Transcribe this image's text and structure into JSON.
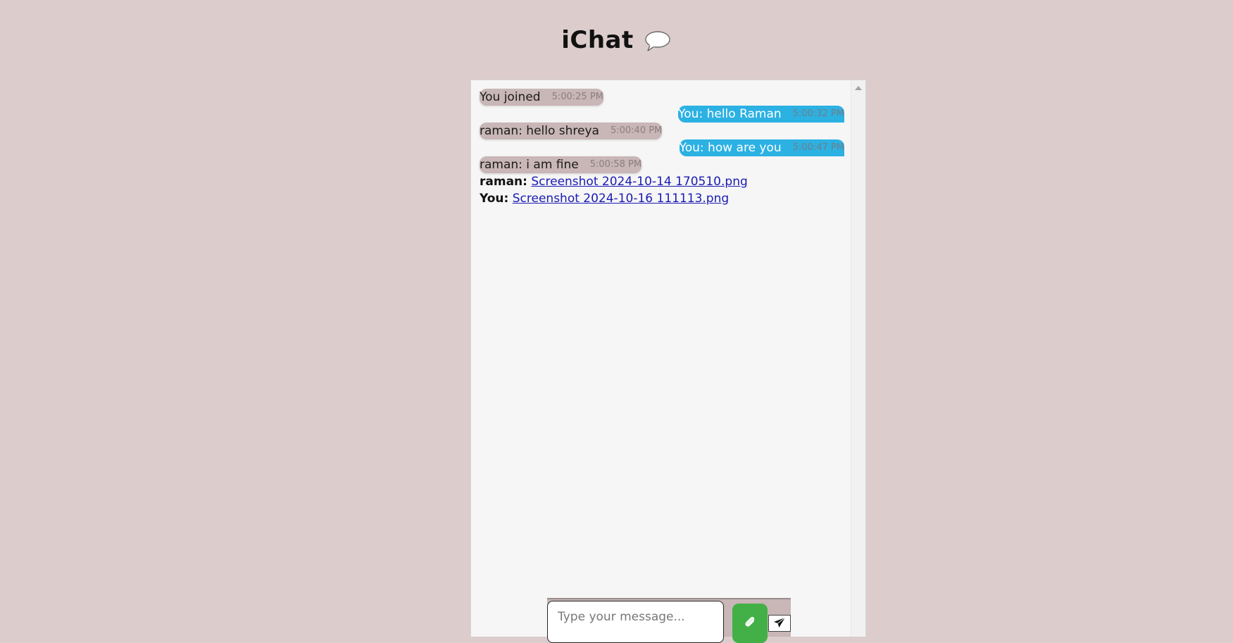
{
  "header": {
    "title": "iChat",
    "icon": "speech-bubble-icon"
  },
  "messages": [
    {
      "type": "text",
      "side": "left",
      "text": "You joined",
      "time": "5:00:25 PM"
    },
    {
      "type": "text",
      "side": "right",
      "text": "You: hello Raman",
      "time": "5:00:32 PM"
    },
    {
      "type": "text",
      "side": "left",
      "text": "raman: hello shreya",
      "time": "5:00:40 PM"
    },
    {
      "type": "text",
      "side": "right",
      "text": "You: how are you",
      "time": "5:00:47 PM"
    },
    {
      "type": "text",
      "side": "left",
      "text": "raman: i am fine",
      "time": "5:00:58 PM"
    },
    {
      "type": "file",
      "sender": "raman:",
      "file_name": "Screenshot 2024-10-14 170510.png"
    },
    {
      "type": "file",
      "sender": "You:",
      "file_name": "Screenshot 2024-10-16 111113.png"
    }
  ],
  "composer": {
    "placeholder": "Type your message...",
    "attach_icon": "paperclip-icon",
    "send_icon": "paper-plane-icon"
  },
  "colors": {
    "page_background": "#dccccc",
    "panel_background": "#f6f6f6",
    "their_bubble": "#c9b6b6",
    "my_bubble": "#2cb1e3",
    "attach_button": "#43b047",
    "link": "#1a1ab5"
  }
}
